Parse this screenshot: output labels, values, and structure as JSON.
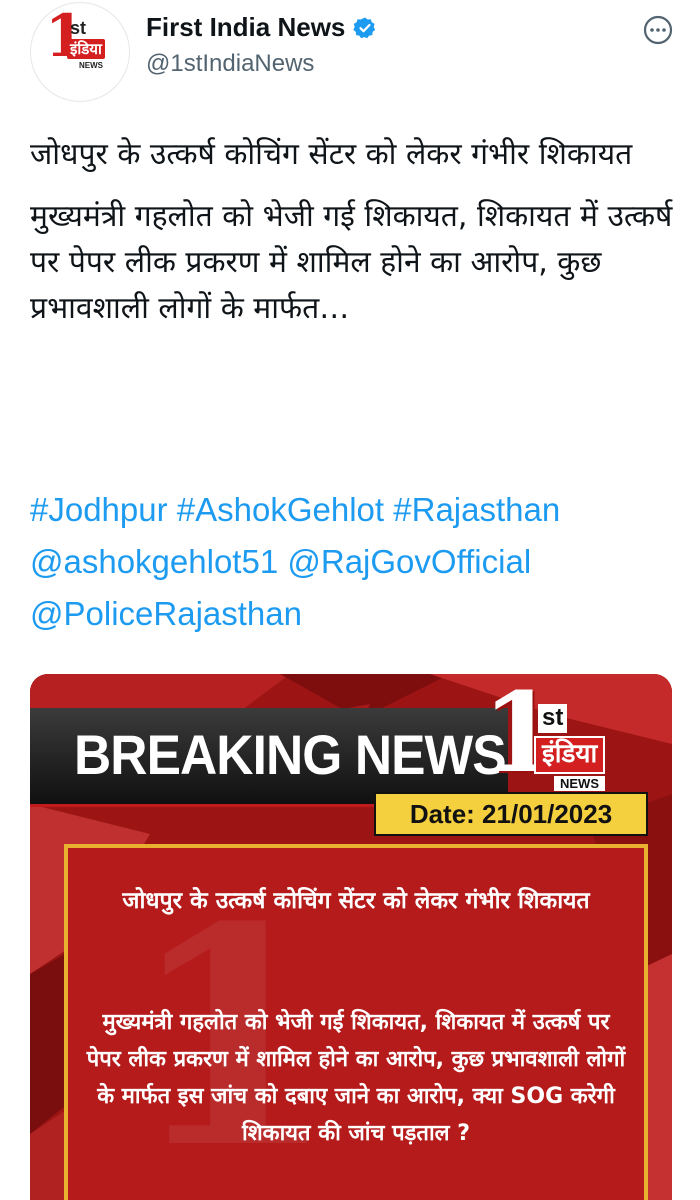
{
  "account": {
    "display_name": "First India News",
    "handle": "@1stIndiaNews",
    "avatar_logo": {
      "big": "1",
      "st": "st",
      "hindi": "इंडिया",
      "news": "NEWS"
    }
  },
  "icons": {
    "verified": "verified-badge-icon",
    "more": "more-options-icon"
  },
  "colors": {
    "link": "#1d9bf0",
    "verified": "#1d9bf0",
    "brand_red": "#d31f1f",
    "date_yellow": "#f4d03f"
  },
  "tweet": {
    "headline": "जोधपुर के उत्कर्ष कोचिंग सेंटर को लेकर गंभीर शिकायत",
    "body": "मुख्यमंत्री गहलोत को भेजी गई शिकायत, शिकायत में उत्कर्ष पर पेपर लीक प्रकरण में शामिल होने का आरोप, कुछ प्रभावशाली लोगों के मार्फत…",
    "hashtags": [
      "#Jodhpur",
      "#AshokGehlot",
      "#Rajasthan"
    ],
    "mentions": [
      "@ashokgehlot51",
      "@RajGovOfficial",
      "@PoliceRajasthan"
    ]
  },
  "media": {
    "banner": "BREAKING NEWS",
    "logo": {
      "big": "1",
      "st": "st",
      "hindi": "इंडिया",
      "news": "NEWS"
    },
    "date": "Date: 21/01/2023",
    "headline": "जोधपुर के उत्कर्ष कोचिंग सेंटर को लेकर गंभीर शिकायत",
    "body": "मुख्यमंत्री गहलोत को भेजी गई शिकायत, शिकायत में उत्कर्ष पर पेपर लीक प्रकरण में शामिल होने का आरोप, कुछ प्रभावशाली लोगों के मार्फत इस जांच को दबाए जाने का आरोप, क्या SOG करेगी शिकायत की जांच पड़ताल ?"
  }
}
